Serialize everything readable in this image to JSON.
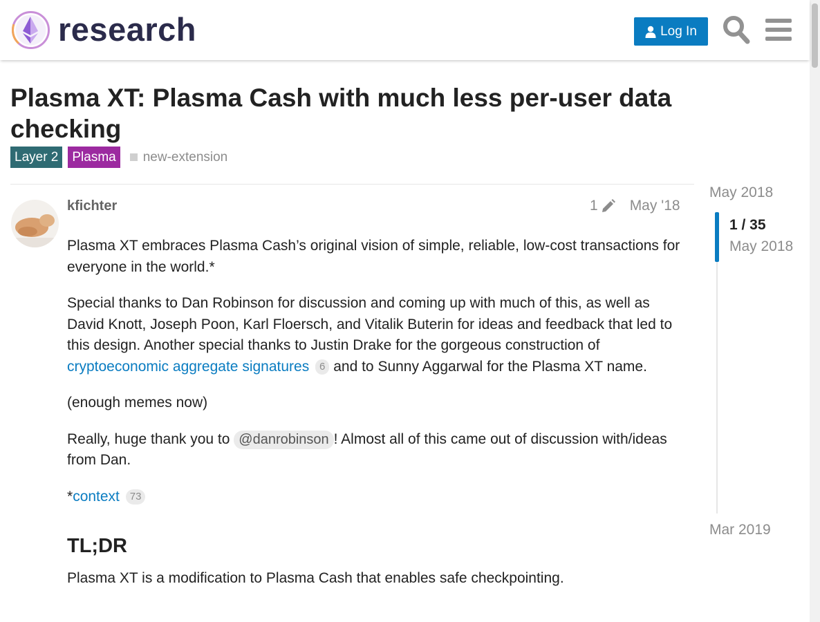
{
  "header": {
    "site_name": "research",
    "login_label": "Log In",
    "logo_icon": "ethereum-research-logo",
    "search_icon": "search-icon",
    "menu_icon": "hamburger-menu-icon",
    "accent_color": "#0a7cc1"
  },
  "topic": {
    "title": "Plasma XT: Plasma Cash with much less per-user data checking",
    "categories": [
      {
        "label": "Layer 2",
        "color": "#2f6b73"
      },
      {
        "label": "Plasma",
        "color": "#9c2aa0"
      }
    ],
    "tags": [
      "new-extension"
    ]
  },
  "post": {
    "username": "kfichter",
    "edit_count": "1",
    "date": "May '18",
    "p1": "Plasma XT embraces Plasma Cash’s original vision of simple, reliable, low-cost transactions for everyone in the world.*",
    "p2_before": "Special thanks to Dan Robinson for discussion and coming up with much of this, as well as David Knott, Joseph Poon, Karl Floersch, and Vitalik Buterin for ideas and feedback that led to this design. Another special thanks to Justin Drake for the gorgeous construction of ",
    "p2_link": "cryptoeconomic aggregate signatures",
    "p2_link_clicks": "6",
    "p2_after": " and to Sunny Aggarwal for the Plasma XT name.",
    "p3": "(enough memes now)",
    "p4_before": "Really, huge thank you to ",
    "p4_mention": "@danrobinson",
    "p4_after": "! Almost all of this came out of discussion with/ideas from Dan.",
    "p5_prefix": "*",
    "p5_link": "context",
    "p5_link_clicks": "73",
    "heading": "TL;DR",
    "p6": "Plasma XT is a modification to Plasma Cash that enables safe checkpointing."
  },
  "timeline": {
    "start_date": "May 2018",
    "position": "1 / 35",
    "position_date": "May 2018",
    "end_date": "Mar 2019"
  }
}
